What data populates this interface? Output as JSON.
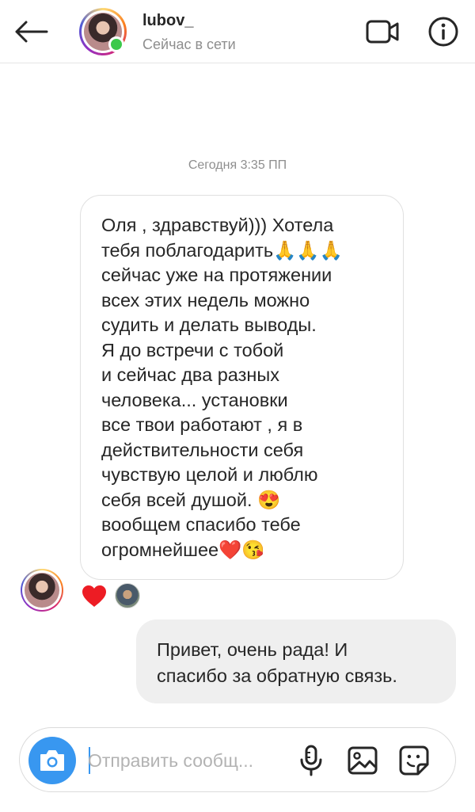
{
  "header": {
    "username": "lubov_",
    "status": "Сейчас в сети",
    "icons": {
      "back": "arrow-left-icon",
      "video": "video-camera-icon",
      "info": "info-icon"
    }
  },
  "thread": {
    "timestamp": "Сегодня 3:35 ПП",
    "incoming_message": "Оля , здравствуй))) Хотела\nтебя поблагодарить🙏🙏🙏\nсейчас уже на протяжении\nвсех этих недель можно\nсудить и делать выводы.\nЯ до встречи с тобой\nи сейчас два разных\nчеловека... установки\nвсе твои работают , я в\nдействительности себя\nчувствую целой и люблю\nсебя всей душой. 😍\nвообщем спасибо тебе\nогромнейшее❤️😘",
    "reaction": "❤️",
    "outgoing_message": "Привет, очень рада! И\nспасибо за обратную связь."
  },
  "composer": {
    "placeholder": "Отправить сообщ...",
    "value": "",
    "icons": {
      "camera": "camera-icon",
      "mic": "microphone-icon",
      "gallery": "gallery-icon",
      "sticker": "sticker-icon"
    }
  },
  "colors": {
    "accent": "#3897f0",
    "online": "#3cc94a",
    "outgoing_bubble": "#efefef",
    "heart": "#ed1c24"
  }
}
